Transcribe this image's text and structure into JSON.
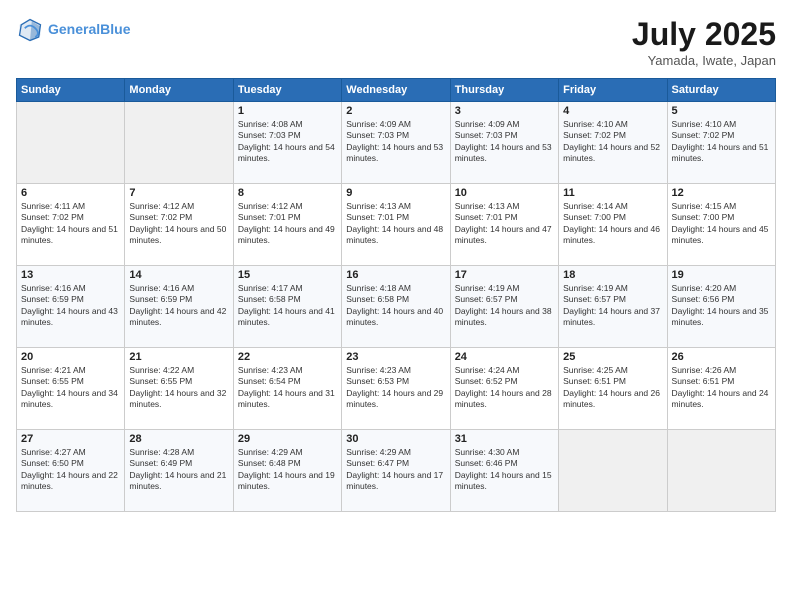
{
  "header": {
    "logo_line1": "General",
    "logo_line2": "Blue",
    "month": "July 2025",
    "location": "Yamada, Iwate, Japan"
  },
  "weekdays": [
    "Sunday",
    "Monday",
    "Tuesday",
    "Wednesday",
    "Thursday",
    "Friday",
    "Saturday"
  ],
  "weeks": [
    [
      {
        "day": "",
        "empty": true
      },
      {
        "day": "",
        "empty": true
      },
      {
        "day": "1",
        "sunrise": "4:08 AM",
        "sunset": "7:03 PM",
        "daylight": "14 hours and 54 minutes."
      },
      {
        "day": "2",
        "sunrise": "4:09 AM",
        "sunset": "7:03 PM",
        "daylight": "14 hours and 53 minutes."
      },
      {
        "day": "3",
        "sunrise": "4:09 AM",
        "sunset": "7:03 PM",
        "daylight": "14 hours and 53 minutes."
      },
      {
        "day": "4",
        "sunrise": "4:10 AM",
        "sunset": "7:02 PM",
        "daylight": "14 hours and 52 minutes."
      },
      {
        "day": "5",
        "sunrise": "4:10 AM",
        "sunset": "7:02 PM",
        "daylight": "14 hours and 51 minutes."
      }
    ],
    [
      {
        "day": "6",
        "sunrise": "4:11 AM",
        "sunset": "7:02 PM",
        "daylight": "14 hours and 51 minutes."
      },
      {
        "day": "7",
        "sunrise": "4:12 AM",
        "sunset": "7:02 PM",
        "daylight": "14 hours and 50 minutes."
      },
      {
        "day": "8",
        "sunrise": "4:12 AM",
        "sunset": "7:01 PM",
        "daylight": "14 hours and 49 minutes."
      },
      {
        "day": "9",
        "sunrise": "4:13 AM",
        "sunset": "7:01 PM",
        "daylight": "14 hours and 48 minutes."
      },
      {
        "day": "10",
        "sunrise": "4:13 AM",
        "sunset": "7:01 PM",
        "daylight": "14 hours and 47 minutes."
      },
      {
        "day": "11",
        "sunrise": "4:14 AM",
        "sunset": "7:00 PM",
        "daylight": "14 hours and 46 minutes."
      },
      {
        "day": "12",
        "sunrise": "4:15 AM",
        "sunset": "7:00 PM",
        "daylight": "14 hours and 45 minutes."
      }
    ],
    [
      {
        "day": "13",
        "sunrise": "4:16 AM",
        "sunset": "6:59 PM",
        "daylight": "14 hours and 43 minutes."
      },
      {
        "day": "14",
        "sunrise": "4:16 AM",
        "sunset": "6:59 PM",
        "daylight": "14 hours and 42 minutes."
      },
      {
        "day": "15",
        "sunrise": "4:17 AM",
        "sunset": "6:58 PM",
        "daylight": "14 hours and 41 minutes."
      },
      {
        "day": "16",
        "sunrise": "4:18 AM",
        "sunset": "6:58 PM",
        "daylight": "14 hours and 40 minutes."
      },
      {
        "day": "17",
        "sunrise": "4:19 AM",
        "sunset": "6:57 PM",
        "daylight": "14 hours and 38 minutes."
      },
      {
        "day": "18",
        "sunrise": "4:19 AM",
        "sunset": "6:57 PM",
        "daylight": "14 hours and 37 minutes."
      },
      {
        "day": "19",
        "sunrise": "4:20 AM",
        "sunset": "6:56 PM",
        "daylight": "14 hours and 35 minutes."
      }
    ],
    [
      {
        "day": "20",
        "sunrise": "4:21 AM",
        "sunset": "6:55 PM",
        "daylight": "14 hours and 34 minutes."
      },
      {
        "day": "21",
        "sunrise": "4:22 AM",
        "sunset": "6:55 PM",
        "daylight": "14 hours and 32 minutes."
      },
      {
        "day": "22",
        "sunrise": "4:23 AM",
        "sunset": "6:54 PM",
        "daylight": "14 hours and 31 minutes."
      },
      {
        "day": "23",
        "sunrise": "4:23 AM",
        "sunset": "6:53 PM",
        "daylight": "14 hours and 29 minutes."
      },
      {
        "day": "24",
        "sunrise": "4:24 AM",
        "sunset": "6:52 PM",
        "daylight": "14 hours and 28 minutes."
      },
      {
        "day": "25",
        "sunrise": "4:25 AM",
        "sunset": "6:51 PM",
        "daylight": "14 hours and 26 minutes."
      },
      {
        "day": "26",
        "sunrise": "4:26 AM",
        "sunset": "6:51 PM",
        "daylight": "14 hours and 24 minutes."
      }
    ],
    [
      {
        "day": "27",
        "sunrise": "4:27 AM",
        "sunset": "6:50 PM",
        "daylight": "14 hours and 22 minutes."
      },
      {
        "day": "28",
        "sunrise": "4:28 AM",
        "sunset": "6:49 PM",
        "daylight": "14 hours and 21 minutes."
      },
      {
        "day": "29",
        "sunrise": "4:29 AM",
        "sunset": "6:48 PM",
        "daylight": "14 hours and 19 minutes."
      },
      {
        "day": "30",
        "sunrise": "4:29 AM",
        "sunset": "6:47 PM",
        "daylight": "14 hours and 17 minutes."
      },
      {
        "day": "31",
        "sunrise": "4:30 AM",
        "sunset": "6:46 PM",
        "daylight": "14 hours and 15 minutes."
      },
      {
        "day": "",
        "empty": true
      },
      {
        "day": "",
        "empty": true
      }
    ]
  ]
}
